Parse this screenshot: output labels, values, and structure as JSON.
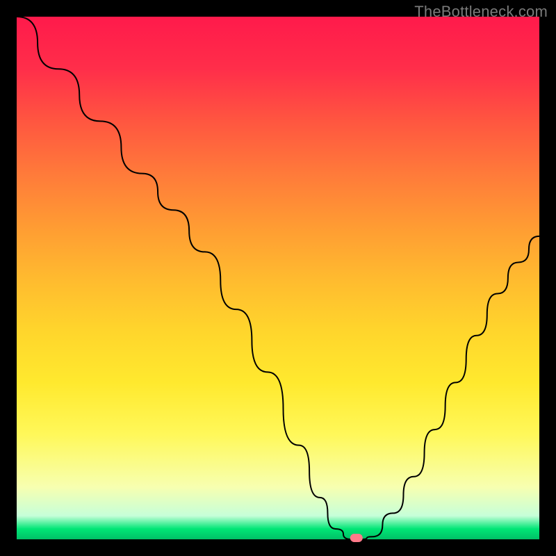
{
  "watermark": "TheBottleneck.com",
  "colors": {
    "frame": "#000000",
    "gradient_top": "#ff1a4b",
    "gradient_bottom": "#00c066",
    "curve": "#000000",
    "marker": "#ff7a8a"
  },
  "chart_data": {
    "type": "line",
    "title": "",
    "xlabel": "",
    "ylabel": "",
    "xlim": [
      0,
      100
    ],
    "ylim": [
      0,
      100
    ],
    "series": [
      {
        "name": "bottleneck-curve",
        "x": [
          0,
          8,
          16,
          24,
          30,
          36,
          42,
          48,
          54,
          58,
          61,
          64,
          66,
          68,
          72,
          76,
          80,
          84,
          88,
          92,
          96,
          100
        ],
        "values": [
          100,
          90,
          80,
          70,
          63,
          55,
          44,
          32,
          18,
          8,
          2,
          0,
          0,
          0.5,
          5,
          12,
          21,
          30,
          39,
          47,
          53,
          58
        ]
      }
    ],
    "annotations": [
      {
        "name": "min-marker",
        "x": 65,
        "y": 0
      }
    ]
  }
}
